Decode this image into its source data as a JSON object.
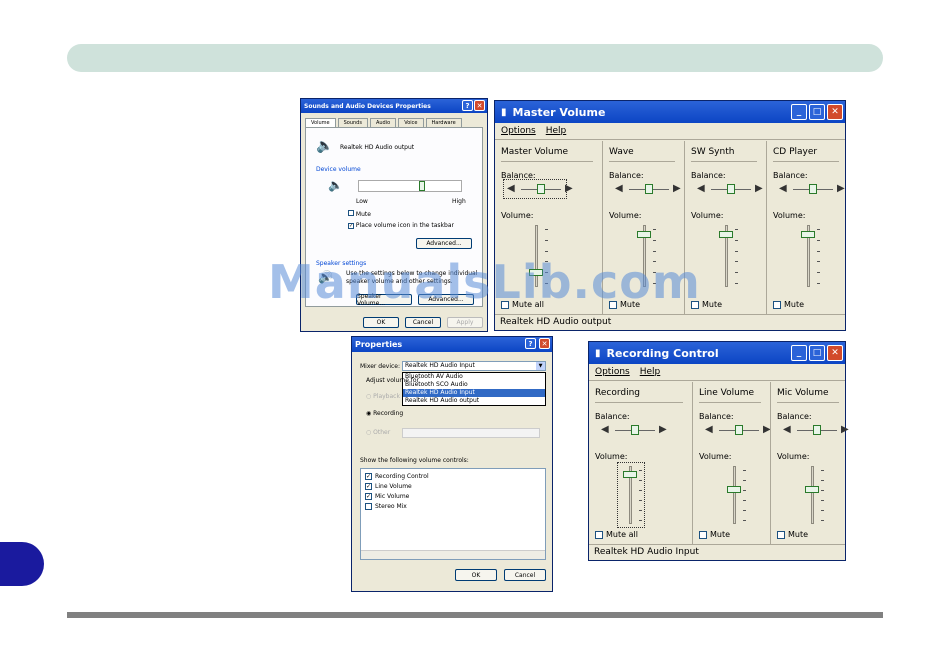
{
  "watermark": "ManualsLib.com",
  "sound_dialog": {
    "title": "Sounds and Audio Devices Properties",
    "tabs": [
      "Volume",
      "Sounds",
      "Audio",
      "Voice",
      "Hardware"
    ],
    "device_name": "Realtek HD Audio output",
    "device_volume_label": "Device volume",
    "low_label": "Low",
    "high_label": "High",
    "device_volume_level": 0.62,
    "mute_label": "Mute",
    "taskbar_label": "Place volume icon in the taskbar",
    "advanced_btn": "Advanced...",
    "speaker_settings_label": "Speaker settings",
    "speaker_text_1": "Use the settings below to change individual",
    "speaker_text_2": "speaker volume and other settings.",
    "speaker_volume_btn": "Speaker Volume...",
    "speaker_advanced_btn": "Advanced...",
    "ok": "OK",
    "cancel": "Cancel",
    "apply": "Apply"
  },
  "master_volume": {
    "title": "Master Volume",
    "menu": [
      "Options",
      "Help"
    ],
    "columns": [
      {
        "name": "Master Volume",
        "mute_label": "Mute all",
        "balance": 0.5,
        "volume": 0.2
      },
      {
        "name": "Wave",
        "mute_label": "Mute",
        "balance": 0.5,
        "volume": 0.9
      },
      {
        "name": "SW Synth",
        "mute_label": "Mute",
        "balance": 0.5,
        "volume": 0.9
      },
      {
        "name": "CD Player",
        "mute_label": "Mute",
        "balance": 0.5,
        "volume": 0.9
      }
    ],
    "balance_label": "Balance:",
    "volume_label": "Volume:",
    "status": "Realtek HD Audio output"
  },
  "properties": {
    "title": "Properties",
    "mixer_label": "Mixer device:",
    "mixer_value": "Realtek HD Audio Input",
    "dropdown_options": [
      "Bluetooth AV Audio",
      "Bluetooth SCO Audio",
      "Realtek HD Audio Input",
      "Realtek HD Audio output"
    ],
    "selected_index": 2,
    "adjust_label": "Adjust volume for",
    "playback_label": "Playback",
    "recording_label": "Recording",
    "other_label": "Other",
    "show_label": "Show the following volume controls:",
    "controls": [
      {
        "label": "Recording Control",
        "checked": true
      },
      {
        "label": "Line Volume",
        "checked": true
      },
      {
        "label": "Mic Volume",
        "checked": true
      },
      {
        "label": "Stereo Mix",
        "checked": false
      }
    ],
    "ok": "OK",
    "cancel": "Cancel"
  },
  "recording_control": {
    "title": "Recording Control",
    "menu": [
      "Options",
      "Help"
    ],
    "columns": [
      {
        "name": "Recording",
        "mute_label": "Mute all",
        "balance": 0.5,
        "volume": 0.9
      },
      {
        "name": "Line Volume",
        "mute_label": "Mute",
        "balance": 0.5,
        "volume": 0.6
      },
      {
        "name": "Mic Volume",
        "mute_label": "Mute",
        "balance": 0.5,
        "volume": 0.6
      }
    ],
    "balance_label": "Balance:",
    "volume_label": "Volume:",
    "status": "Realtek HD Audio Input"
  }
}
